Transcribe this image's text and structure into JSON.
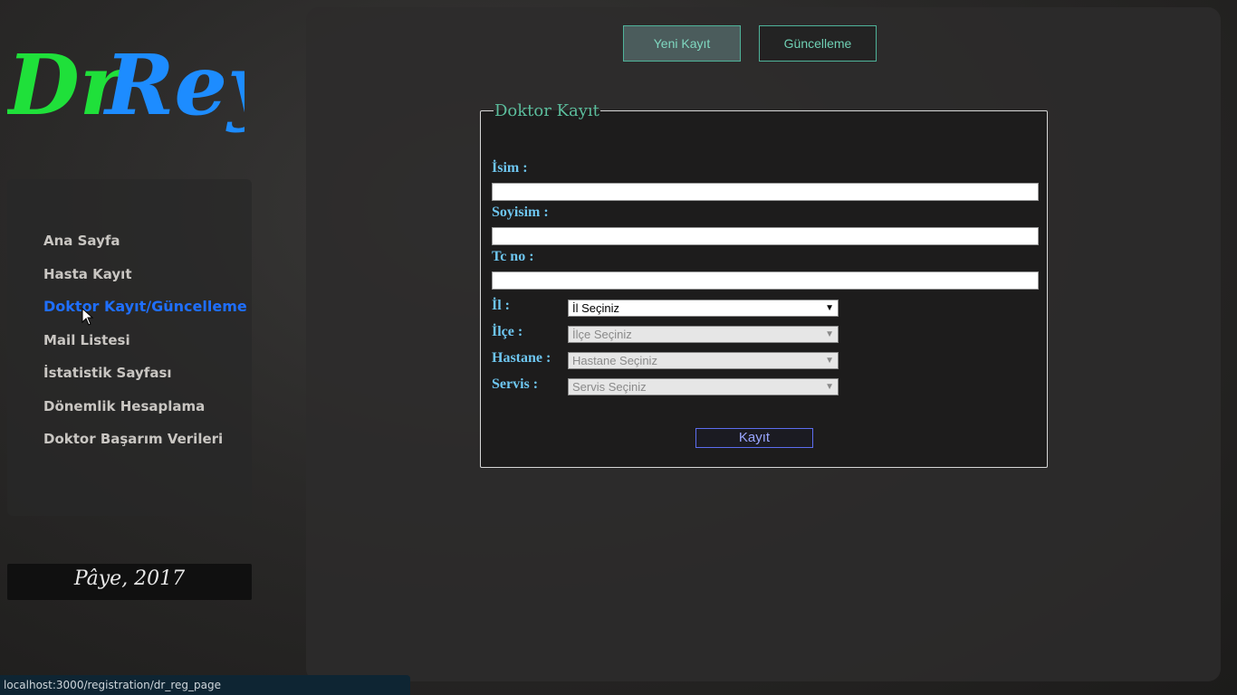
{
  "logo": {
    "text_part1": "Dr",
    "text_part2": "Rey",
    "color1": "#1fe03a",
    "color2": "#1d8cff"
  },
  "sidebar": {
    "items": [
      {
        "label": "Ana Sayfa"
      },
      {
        "label": "Hasta Kayıt"
      },
      {
        "label": "Doktor Kayıt/Güncelleme",
        "active": true
      },
      {
        "label": "Mail Listesi"
      },
      {
        "label": "İstatistik Sayfası"
      },
      {
        "label": "Dönemlik Hesaplama"
      },
      {
        "label": "Doktor Başarım Verileri"
      }
    ],
    "footer": "Pâye, 2017"
  },
  "tabs": {
    "new_label": "Yeni Kayıt",
    "update_label": "Güncelleme"
  },
  "form": {
    "title": "Doktor Kayıt",
    "name_label": "İsim :",
    "surname_label": "Soyisim :",
    "tc_label": "Tc no :",
    "city_label": "İl :",
    "city_select": "İl Seçiniz",
    "district_label": "İlçe :",
    "district_select": "İlçe Seçiniz",
    "hospital_label": "Hastane :",
    "hospital_select": "Hastane Seçiniz",
    "service_label": "Servis :",
    "service_select": "Servis Seçiniz",
    "submit_label": "Kayıt"
  },
  "status_bar": {
    "url": "localhost:3000/registration/dr_reg_page"
  },
  "colors": {
    "accent_green": "#5bbd9c",
    "label_blue": "#6ec6f0",
    "active_nav": "#1f6fff"
  }
}
